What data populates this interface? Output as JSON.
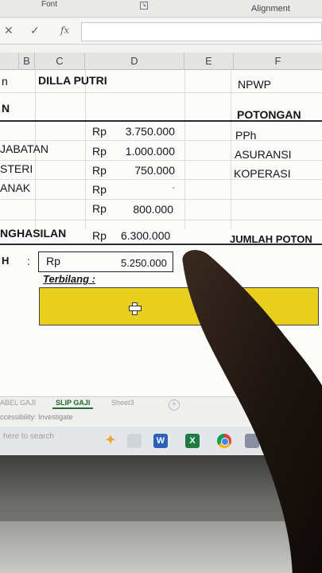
{
  "ribbon": {
    "font_group": "Font",
    "alignment_group": "Alignment"
  },
  "formula_bar": {
    "cancel": "✕",
    "enter": "✓",
    "fx": "fx"
  },
  "columns": [
    "B",
    "C",
    "D",
    "E",
    "F"
  ],
  "rows": {
    "name_label": "n",
    "name_value": "DILLA PUTRI",
    "npwp": "NPWP",
    "section_left": "N",
    "potongan": "POTONGAN",
    "r1_label": "",
    "r1_cur": "Rp",
    "r1_val": "3.750.000",
    "r1_right": "PPh",
    "r2_label": "JABATAN",
    "r2_cur": "Rp",
    "r2_val": "1.000.000",
    "r2_right": "ASURANSI",
    "r3_label": "STERI",
    "r3_cur": "Rp",
    "r3_val": "750.000",
    "r3_right": "KOPERASI",
    "r4_label": "ANAK",
    "r4_cur": "Rp",
    "r4_val": "-",
    "r5_cur": "Rp",
    "r5_val": "800.000",
    "total_label": "NGHASILAN",
    "total_cur": "Rp",
    "total_val": "6.300.000",
    "total_right": "JUMLAH POTON",
    "net_label": "H",
    "net_colon": ":",
    "net_cur": "Rp",
    "net_val": "5.250.000",
    "terbilang": "Terbilang :"
  },
  "sheet_tabs": [
    "ABEL GAJI",
    "SLIP GAJI",
    "Sheet3"
  ],
  "add_sheet": "+",
  "status": "ccessibility: Investigate",
  "taskbar": {
    "search_placeholder": "here to search"
  }
}
